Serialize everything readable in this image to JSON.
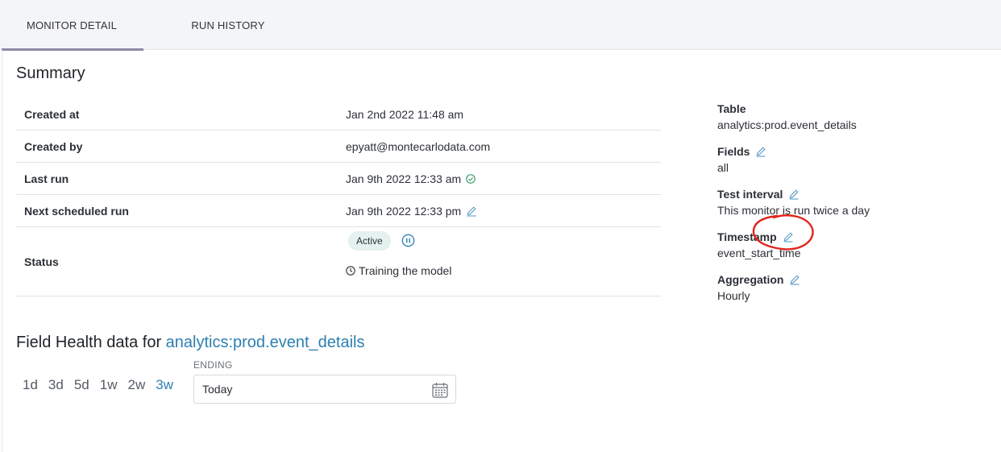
{
  "tabs": [
    {
      "label": "MONITOR DETAIL",
      "active": true
    },
    {
      "label": "RUN HISTORY",
      "active": false
    }
  ],
  "summary": {
    "title": "Summary",
    "rows": {
      "created_at": {
        "label": "Created at",
        "value": "Jan 2nd 2022 11:48 am"
      },
      "created_by": {
        "label": "Created by",
        "value": "epyatt@montecarlodata.com"
      },
      "last_run": {
        "label": "Last run",
        "value": "Jan 9th 2022 12:33 am",
        "status_icon": "check-circle-icon"
      },
      "next_run": {
        "label": "Next scheduled run",
        "value": "Jan 9th 2022 12:33 pm",
        "edit_icon": "pencil-icon"
      },
      "status": {
        "label": "Status",
        "badge": "Active",
        "pause_icon": "pause-circle-icon",
        "training": "Training the model"
      }
    }
  },
  "details": {
    "table": {
      "label": "Table",
      "value": "analytics:prod.event_details"
    },
    "fields": {
      "label": "Fields",
      "value": "all"
    },
    "test_interval": {
      "label": "Test interval",
      "value": "This monitor is run twice a day"
    },
    "timestamp": {
      "label": "Timestamp",
      "value": "event_start_time"
    },
    "aggregation": {
      "label": "Aggregation",
      "value": "Hourly"
    }
  },
  "field_health": {
    "title_prefix": "Field Health data for ",
    "table_link": "analytics:prod.event_details",
    "ranges": [
      "1d",
      "3d",
      "5d",
      "1w",
      "2w",
      "3w"
    ],
    "selected_range": "3w",
    "ending_label": "ENDING",
    "ending_value": "Today"
  },
  "colors": {
    "link": "#2c7fb0",
    "accent_underline": "#8e8aa8",
    "success": "#3aa26a",
    "annotation": "#e0261b"
  }
}
